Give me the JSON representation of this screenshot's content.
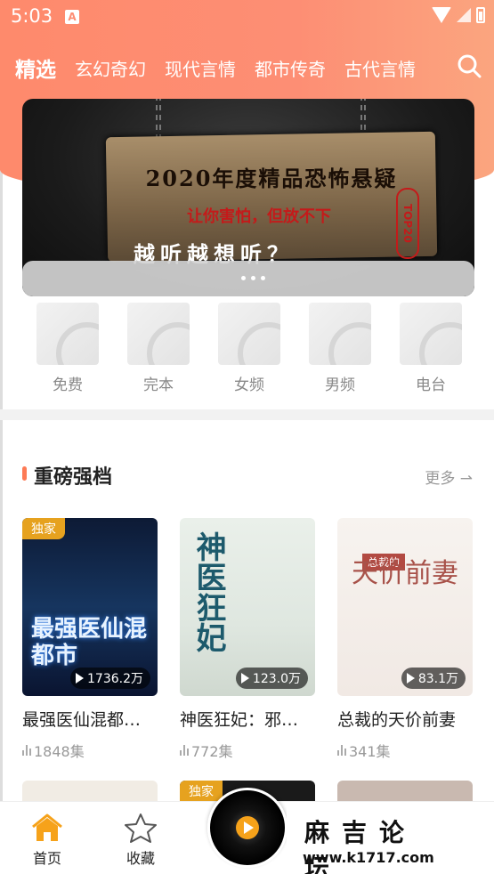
{
  "status": {
    "time": "5:03",
    "app_icon_letter": "A"
  },
  "tabs": [
    {
      "label": "精选",
      "active": true
    },
    {
      "label": "玄幻奇幻",
      "active": false
    },
    {
      "label": "现代言情",
      "active": false
    },
    {
      "label": "都市传奇",
      "active": false
    },
    {
      "label": "古代言情",
      "active": false
    }
  ],
  "banner": {
    "title": "2020年度精品恐怖悬疑",
    "subtitle": "让你害怕，但放不下",
    "slogan": "越听越想听？",
    "badge": "TOP20"
  },
  "categories": [
    {
      "label": "免费"
    },
    {
      "label": "完本"
    },
    {
      "label": "女频"
    },
    {
      "label": "男频"
    },
    {
      "label": "电台"
    }
  ],
  "section": {
    "title": "重磅强档",
    "more_label": "更多"
  },
  "books": [
    {
      "title": "最强医仙混都…",
      "plays": "1736.2万",
      "episodes": "1848集",
      "exclusive": "独家",
      "cover_text": "最强医仙混都市"
    },
    {
      "title": "神医狂妃：邪…",
      "plays": "123.0万",
      "episodes": "772集",
      "exclusive": "",
      "cover_text": "神医狂妃"
    },
    {
      "title": "总裁的天价前妻",
      "plays": "83.1万",
      "episodes": "341集",
      "exclusive": "",
      "cover_text": "天价前妻",
      "cover_tag": "总裁的"
    }
  ],
  "row2": [
    {
      "exclusive": ""
    },
    {
      "exclusive": "独家"
    },
    {
      "exclusive": ""
    }
  ],
  "nav": {
    "home": "首页",
    "favorites": "收藏"
  },
  "watermark": {
    "name": "麻吉论坛",
    "url": "www.k1717.com"
  },
  "colors": {
    "accent": "#fd8e74",
    "exclusive": "#e6a21f",
    "home_active": "#f6a21a"
  }
}
